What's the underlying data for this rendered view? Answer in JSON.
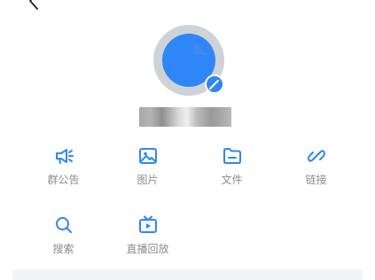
{
  "colors": {
    "accent": "#2f86f6",
    "label": "#8a8d93",
    "avatar_ring": "#cfd2d6",
    "divider": "#f3f4f6"
  },
  "header": {
    "back_icon": "chevron-left-icon"
  },
  "profile": {
    "avatar_icon": "avatar",
    "edit_icon": "pencil-icon"
  },
  "actions": [
    {
      "label": "群公告",
      "icon": "megaphone-icon"
    },
    {
      "label": "图片",
      "icon": "image-icon"
    },
    {
      "label": "文件",
      "icon": "folder-icon"
    },
    {
      "label": "链接",
      "icon": "link-icon"
    },
    {
      "label": "搜索",
      "icon": "search-icon"
    },
    {
      "label": "直播回放",
      "icon": "tv-play-icon"
    }
  ]
}
